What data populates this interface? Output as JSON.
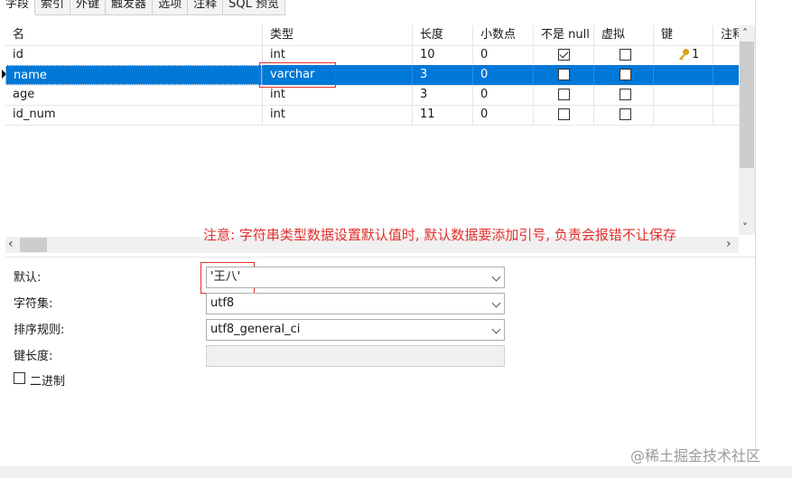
{
  "tabs": [
    "字段",
    "索引",
    "外键",
    "触发器",
    "选项",
    "注释",
    "SQL 预览"
  ],
  "columns": [
    "名",
    "类型",
    "长度",
    "小数点",
    "不是 null",
    "虚拟",
    "键",
    "注释"
  ],
  "rows": [
    {
      "name": "id",
      "type": "int",
      "length": "10",
      "decimals": "0",
      "not_null": true,
      "virtual": false,
      "key": "1",
      "selected": false
    },
    {
      "name": "name",
      "type": "varchar",
      "length": "3",
      "decimals": "0",
      "not_null": false,
      "virtual": false,
      "key": "",
      "selected": true
    },
    {
      "name": "age",
      "type": "int",
      "length": "3",
      "decimals": "0",
      "not_null": false,
      "virtual": false,
      "key": "",
      "selected": false
    },
    {
      "name": "id_num",
      "type": "int",
      "length": "11",
      "decimals": "0",
      "not_null": false,
      "virtual": false,
      "key": "",
      "selected": false
    }
  ],
  "annotation": "注意: 字符串类型数据设置默认值时, 默认数据要添加引号, 负责会报错不让保存",
  "props": {
    "default_label": "默认:",
    "default_value": "'王八'",
    "charset_label": "字符集:",
    "charset_value": "utf8",
    "collation_label": "排序规则:",
    "collation_value": "utf8_general_ci",
    "keylen_label": "键长度:",
    "keylen_value": "",
    "binary_label": "二进制"
  },
  "watermark": "@稀土掘金技术社区",
  "colors": {
    "selection": "#0078d7",
    "annotation": "#e0302c",
    "key": "#d6a21e"
  }
}
